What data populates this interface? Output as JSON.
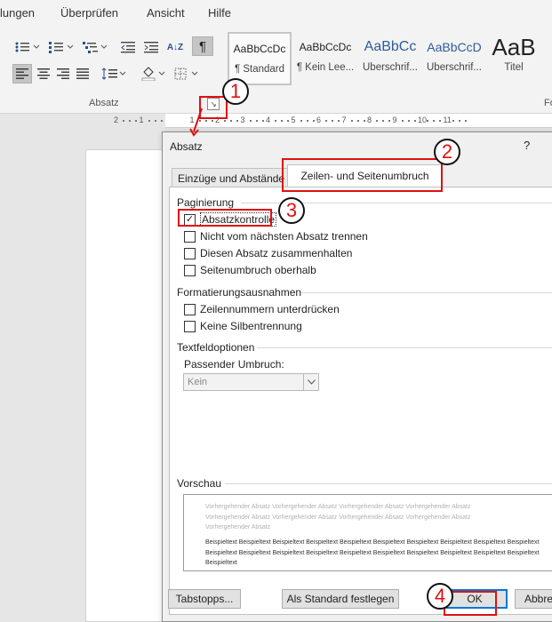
{
  "menu": {
    "items": [
      "lungen",
      "Überprüfen",
      "Ansicht",
      "Hilfe"
    ]
  },
  "ribbon": {
    "group_label": "Absatz",
    "next_group_label": "Fo",
    "launcher_icon": "dialog-launcher-icon",
    "sort_label": "A↓Z",
    "pilcrow": "¶",
    "styles": [
      {
        "preview": "AaBbCcDc",
        "label": "¶ Standard",
        "selected": true
      },
      {
        "preview": "AaBbCcDc",
        "label": "¶ Kein Lee...",
        "selected": false
      },
      {
        "preview": "AaBbCc",
        "label": "Überschrif...",
        "selected": false
      },
      {
        "preview": "AaBbCcD",
        "label": "Überschrif...",
        "selected": false
      },
      {
        "preview": "AaB",
        "label": "Titel",
        "selected": false
      }
    ]
  },
  "ruler": {
    "labels": [
      "2",
      "1",
      "1",
      "2",
      "3",
      "4",
      "5",
      "6",
      "7",
      "8",
      "9",
      "10",
      "11"
    ]
  },
  "dialog": {
    "title": "Absatz",
    "help": "?",
    "tabs": [
      {
        "label": "Einzüge und Abstände",
        "active": false
      },
      {
        "label": "Zeilen- und Seitenumbruch",
        "active": true
      }
    ],
    "pagination": {
      "heading": "Paginierung",
      "options": [
        {
          "label": "Absatzkontrolle",
          "checked": true
        },
        {
          "label": "Nicht vom nächsten Absatz trennen",
          "checked": false
        },
        {
          "label": "Diesen Absatz zusammenhalten",
          "checked": false
        },
        {
          "label": "Seitenumbruch oberhalb",
          "checked": false
        }
      ]
    },
    "formatting_exceptions": {
      "heading": "Formatierungsausnahmen",
      "options": [
        {
          "label": "Zeilennummern unterdrücken",
          "checked": false
        },
        {
          "label": "Keine Silbentrennung",
          "checked": false
        }
      ]
    },
    "textbox_options": {
      "heading": "Textfeldoptionen",
      "fit_label": "Passender Umbruch:",
      "fit_value": "Kein"
    },
    "preview": {
      "heading": "Vorschau",
      "previous_text": "Vorhergehender Absatz Vorhergehender Absatz Vorhergehender Absatz Vorhergehender Absatz Vorhergehender Absatz Vorhergehender Absatz Vorhergehender Absatz Vorhergehender Absatz Vorhergehender Absatz",
      "sample_text": "Beispieltext Beispieltext Beispieltext Beispieltext Beispieltext Beispieltext Beispieltext Beispieltext Beispieltext Beispieltext Beispieltext Beispieltext Beispieltext Beispieltext Beispieltext Beispieltext Beispieltext Beispieltext Beispieltext Beispieltext Beispieltext"
    },
    "buttons": {
      "tabs": "Tabstopps...",
      "default": "Als Standard festlegen",
      "ok": "OK",
      "cancel": "Abbre"
    }
  },
  "callouts": [
    "1",
    "2",
    "3",
    "4"
  ],
  "colors": {
    "callout": "#e01010",
    "focus": "#0078d7"
  }
}
